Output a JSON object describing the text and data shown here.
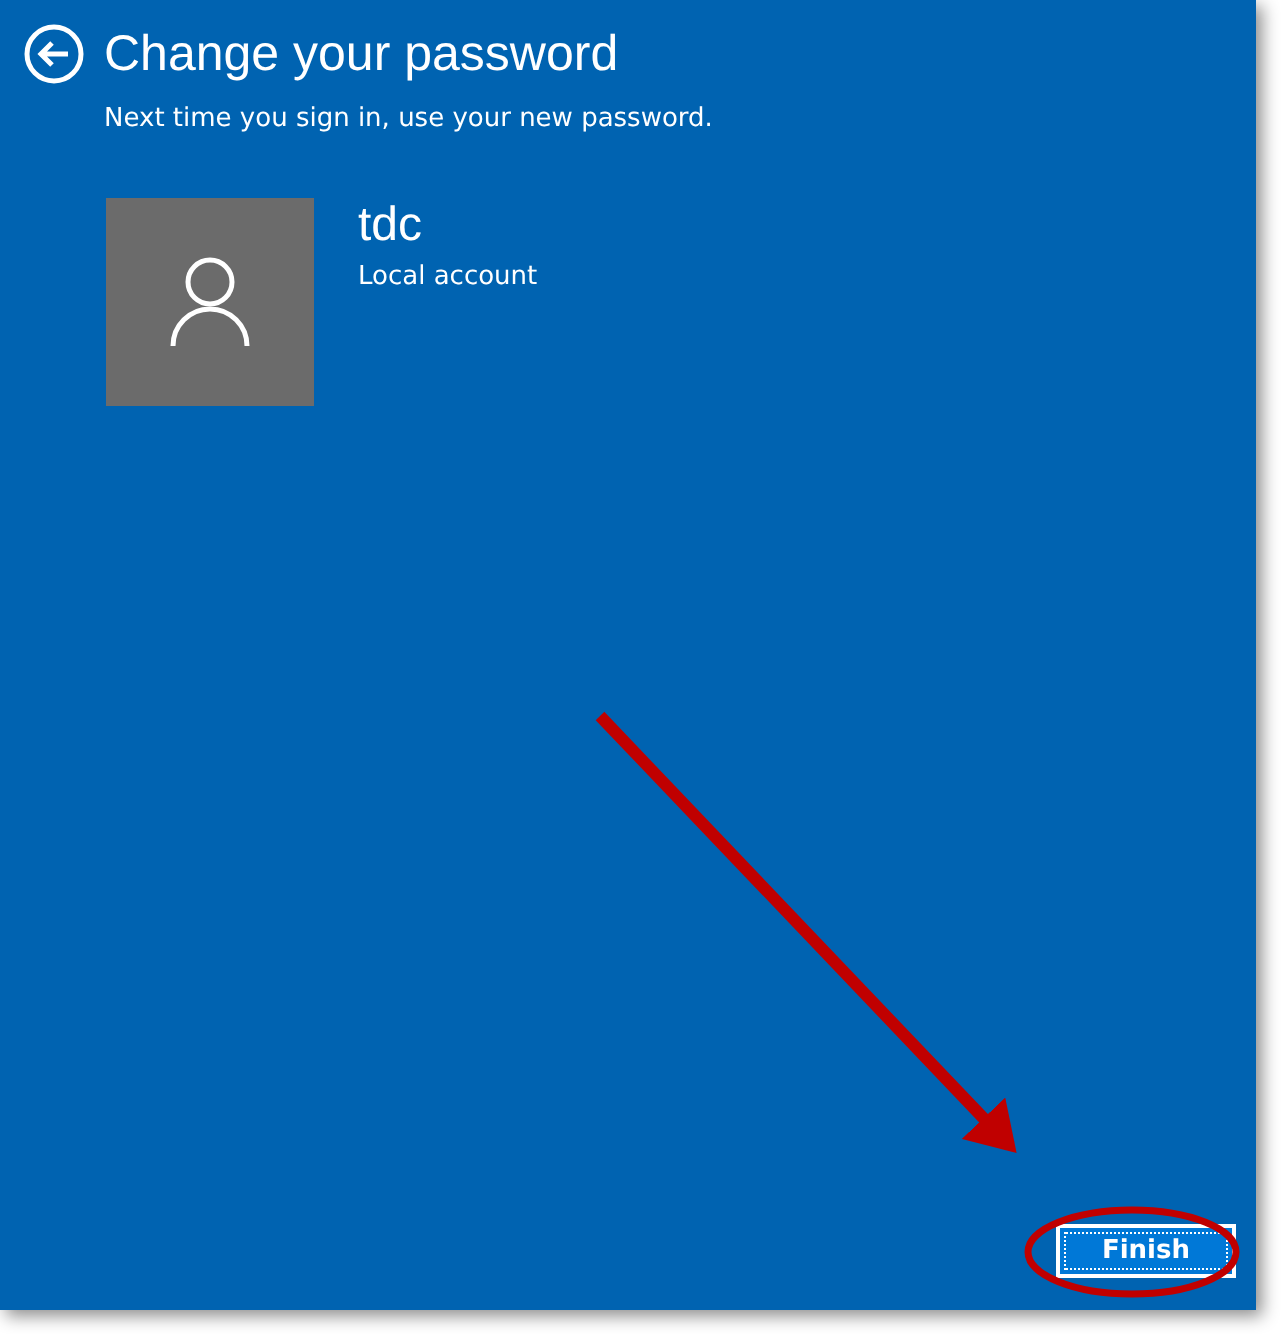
{
  "title": "Change your password",
  "subtitle": "Next time you sign in, use your new password.",
  "account": {
    "name": "tdc",
    "type": "Local account"
  },
  "buttons": [
    {
      "label": "Finish",
      "focused": true
    }
  ]
}
